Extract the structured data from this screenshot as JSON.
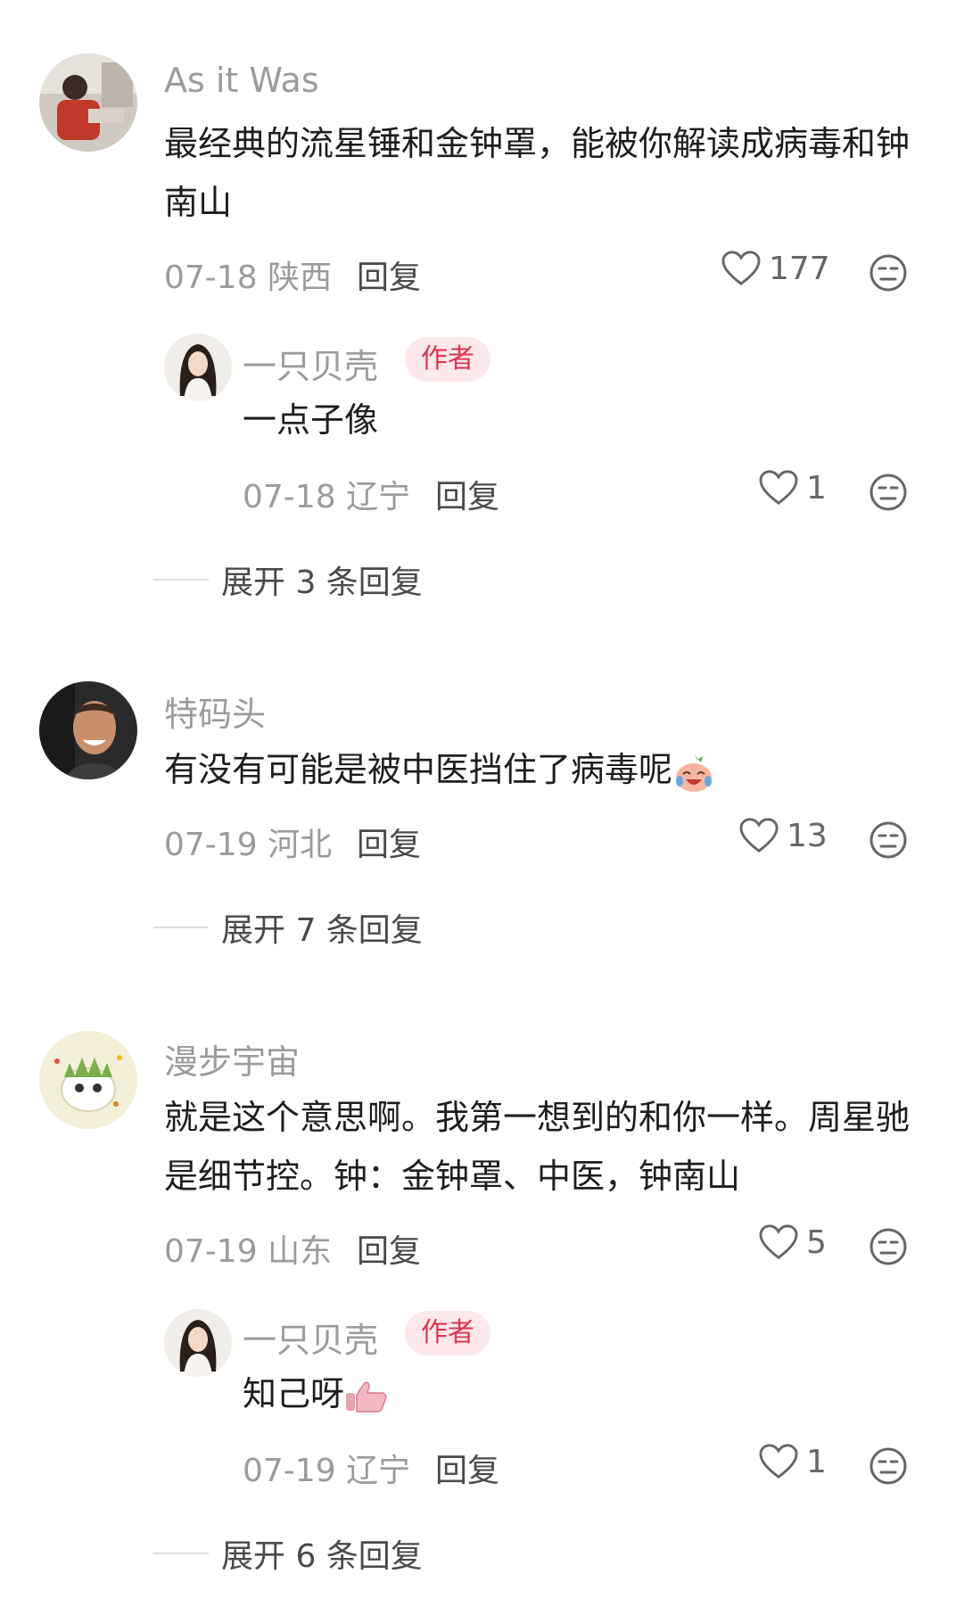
{
  "comments": [
    {
      "username": "As it Was",
      "text": "最经典的流星锤和金钟罩，能被你解读成病毒和钟南山",
      "date": "07-18",
      "location": "陕西",
      "reply_label": "回复",
      "likes": "177",
      "replies": [
        {
          "username": "一只贝壳",
          "badge": "作者",
          "text": "一点子像",
          "date": "07-18",
          "location": "辽宁",
          "reply_label": "回复",
          "likes": "1"
        }
      ],
      "expand_label": "展开 3 条回复"
    },
    {
      "username": "特码头",
      "text": "有没有可能是被中医挡住了病毒呢",
      "date": "07-19",
      "location": "河北",
      "reply_label": "回复",
      "likes": "13",
      "expand_label": "展开 7 条回复"
    },
    {
      "username": "漫步宇宙",
      "text": "就是这个意思啊。我第一想到的和你一样。周星驰是细节控。钟：金钟罩、中医，钟南山",
      "date": "07-19",
      "location": "山东",
      "reply_label": "回复",
      "likes": "5",
      "replies": [
        {
          "username": "一只贝壳",
          "badge": "作者",
          "text": "知己呀",
          "date": "07-19",
          "location": "辽宁",
          "reply_label": "回复",
          "likes": "1"
        }
      ],
      "expand_label": "展开 6 条回复"
    }
  ],
  "icons": {
    "like": "heart-outline-icon",
    "dislike": "meh-face-icon",
    "emoji_1": "crying-laughing-emoji",
    "emoji_2": "thumbs-up-emoji"
  },
  "colors": {
    "badge_bg": "#fde8ec",
    "badge_text": "#e0344f",
    "muted_text": "#9b9b9b"
  }
}
